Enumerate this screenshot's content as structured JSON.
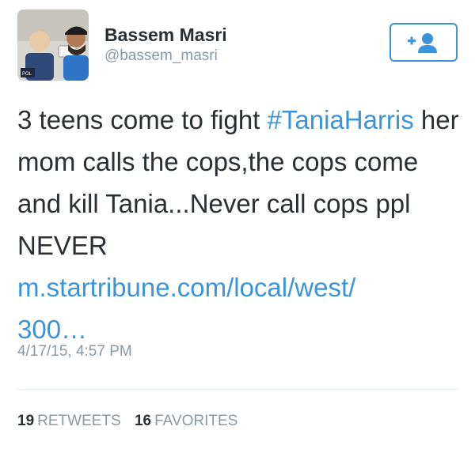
{
  "user": {
    "display_name": "Bassem Masri",
    "handle": "@bassem_masri",
    "avatar_icon": "profile-photo"
  },
  "follow_button": {
    "icon": "add-user-icon"
  },
  "tweet": {
    "text_before_hashtag": "3 teens come to fight ",
    "hashtag": "#TaniaHarris",
    "text_after_hashtag": " her mom calls the cops,the cops come and kill Tania...Never call cops ppl NEVER",
    "link_line1": "m.startribune.com/local/west/",
    "link_line2": "300…",
    "timestamp": "4/17/15, 4:57 PM"
  },
  "stats": {
    "retweets_count": "19",
    "retweets_label": "RETWEETS",
    "favorites_count": "16",
    "favorites_label": "FAVORITES"
  },
  "colors": {
    "accent": "#3b94d9",
    "text": "#292f33",
    "muted": "#8899a6",
    "divider": "#e1e8ed"
  }
}
